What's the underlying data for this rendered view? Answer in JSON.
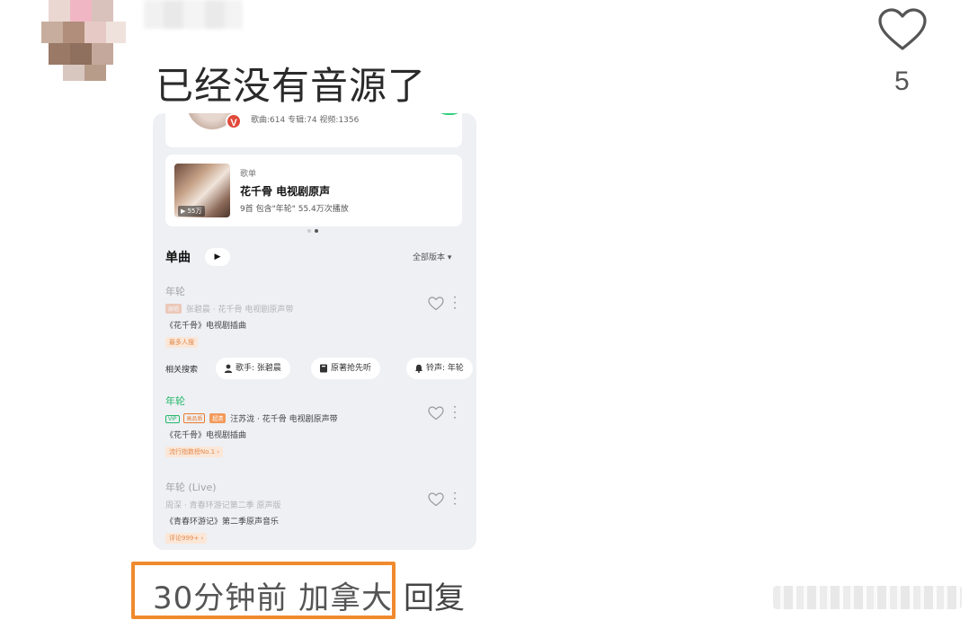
{
  "comment": {
    "text": "已经没有音源了",
    "like_count": "5",
    "time": "30分钟前",
    "location": "加拿大",
    "reply_label": "回复"
  },
  "icons": {
    "like": "heart-outline-icon",
    "verified": "v-badge-icon"
  },
  "screenshot": {
    "artist_card": {
      "badge": "V",
      "stats": "歌曲:614 专辑:74 视频:1356"
    },
    "playlist_card": {
      "type_label": "歌单",
      "title": "花千骨 电视剧原声",
      "play_count_overlay": "▶ 55万",
      "meta": "9首  包含\"年轮\"  55.4万次播放"
    },
    "singles": {
      "section_title": "单曲",
      "play_label": "▶",
      "all_versions": "全部版本 ▾",
      "songs": [
        {
          "title": "年轮",
          "tags": [
            "原唱"
          ],
          "artists": "张碧晨 · 花千骨 电视剧原声带",
          "desc": "《花千骨》电视剧插曲",
          "badge": "最多人搜",
          "style": "faded"
        },
        {
          "title": "年轮",
          "tags": [
            "VIP",
            "高品质",
            "超清"
          ],
          "artists": "汪苏泷 · 花千骨 电视剧原声带",
          "desc": "《花千骨》电视剧插曲",
          "badge": "流行指数榜No.1 ›",
          "style": "green"
        },
        {
          "title": "年轮 (Live)",
          "tags": [],
          "artists": "周深 · 青春环游记第二季 原声版",
          "desc": "《青春环游记》第二季原声音乐",
          "badge": "评论999+ ›",
          "style": "faded-title"
        }
      ]
    },
    "related": {
      "label": "相关搜索",
      "chips": [
        {
          "icon": "person-icon",
          "text": "歌手: 张碧晨"
        },
        {
          "icon": "book-icon",
          "text": "原著抢先听"
        },
        {
          "icon": "bell-icon",
          "text": "铃声: 年轮"
        }
      ]
    }
  },
  "colors": {
    "accent_green": "#25b86a",
    "highlight_orange": "#f08a2e",
    "vip_red": "#e04a3a"
  }
}
